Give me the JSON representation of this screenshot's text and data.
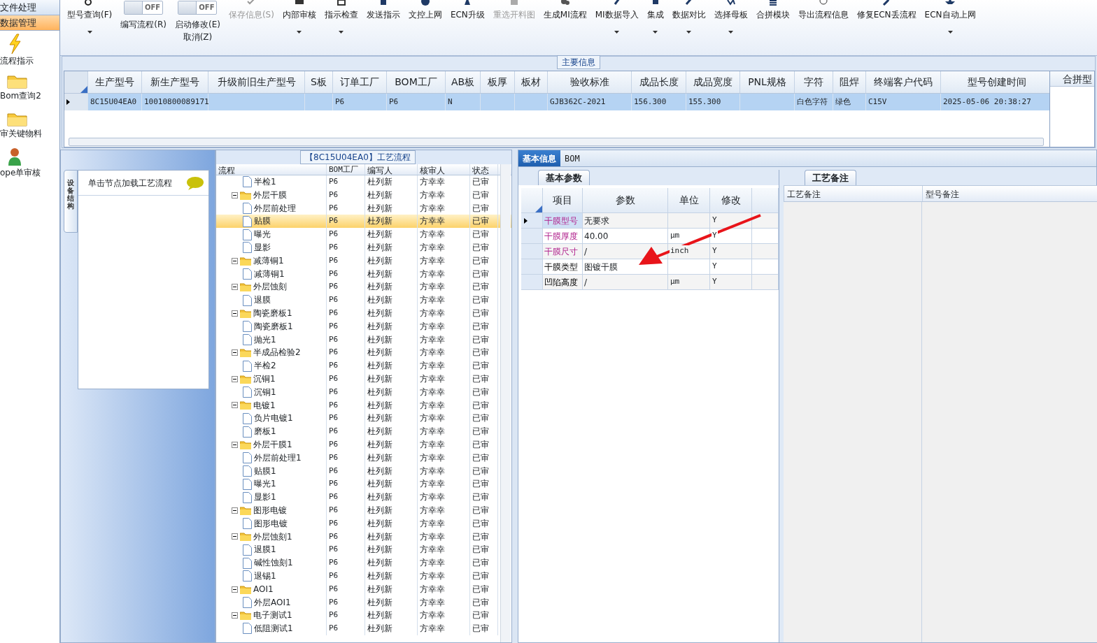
{
  "sidebar": {
    "sections": [
      {
        "label": "文件处理",
        "selected": false
      },
      {
        "label": "数据管理",
        "selected": true
      }
    ],
    "items": [
      {
        "label": "流程指示"
      },
      {
        "label": "Bom查询2"
      },
      {
        "label": "审关键物料"
      },
      {
        "label": "ope单审核"
      }
    ]
  },
  "toolbar": [
    {
      "kind": "button",
      "label": "型号查询(F)",
      "dropdown": true,
      "disabled": false
    },
    {
      "kind": "toggle",
      "label": "编写流程(R)",
      "switch_text": "OFF",
      "on": false
    },
    {
      "kind": "toggle",
      "label": "启动修改(E)",
      "sublabel": "取消(Z)",
      "switch_text": "OFF",
      "on": false
    },
    {
      "kind": "button",
      "label": "保存信息(S)",
      "dropdown": false,
      "disabled": true
    },
    {
      "kind": "button",
      "label": "内部审核",
      "dropdown": true,
      "disabled": false
    },
    {
      "kind": "button",
      "label": "指示检查",
      "dropdown": true,
      "disabled": false
    },
    {
      "kind": "button",
      "label": "发送指示",
      "dropdown": false,
      "disabled": false
    },
    {
      "kind": "button",
      "label": "文控上网",
      "dropdown": false,
      "disabled": false
    },
    {
      "kind": "button",
      "label": "ECN升级",
      "dropdown": false,
      "disabled": false
    },
    {
      "kind": "button",
      "label": "重选开料图",
      "dropdown": false,
      "disabled": true
    },
    {
      "kind": "button",
      "label": "生成MI流程",
      "dropdown": false,
      "disabled": false
    },
    {
      "kind": "button",
      "label": "MI数据导入",
      "dropdown": true,
      "disabled": false
    },
    {
      "kind": "button",
      "label": "集成",
      "dropdown": true,
      "disabled": false
    },
    {
      "kind": "button",
      "label": "数据对比",
      "dropdown": true,
      "disabled": false
    },
    {
      "kind": "button",
      "label": "选择母板",
      "dropdown": true,
      "disabled": false
    },
    {
      "kind": "button",
      "label": "合拼模块",
      "dropdown": false,
      "disabled": false
    },
    {
      "kind": "button",
      "label": "导出流程信息",
      "dropdown": false,
      "disabled": false
    },
    {
      "kind": "button",
      "label": "修复ECN丢流程",
      "dropdown": false,
      "disabled": false
    },
    {
      "kind": "button",
      "label": "ECN自动上网",
      "dropdown": true,
      "disabled": false
    }
  ],
  "main_info": {
    "title": "主要信息",
    "side_header": "合拼型",
    "columns": [
      "生产型号",
      "新生产型号",
      "升级前旧生产型号",
      "S板",
      "订单工厂",
      "BOM工厂",
      "AB板",
      "板厚",
      "板材",
      "验收标准",
      "成品长度",
      "成品宽度",
      "PNL规格",
      "字符",
      "阻焊",
      "终端客户代码",
      "型号创建时间"
    ],
    "rows": [
      {
        "selected": true,
        "cells": [
          "8C15U04EA0",
          "10010800089171",
          "",
          "",
          "P6",
          "P6",
          "N",
          "",
          "",
          "GJB362C-2021",
          "156.300",
          "155.300",
          "",
          "白色字符",
          "绿色",
          "C15V",
          "2025-05-06 20:38:27"
        ]
      }
    ]
  },
  "side_tab": {
    "label": "设备结构"
  },
  "node_panel": {
    "hint": "单击节点加载工艺流程"
  },
  "flow": {
    "title": "【8C15U04EA0】工艺流程",
    "columns": [
      "流程",
      "BOM工厂",
      "编写人",
      "核审人",
      "状态"
    ],
    "items": [
      {
        "kind": "leaf",
        "label": "半检1",
        "bom": "P6",
        "writer": "杜列新",
        "reviewer": "方幸幸",
        "status": "已审",
        "selected": false
      },
      {
        "kind": "folder",
        "label": "外层干膜",
        "bom": "P6",
        "writer": "杜列新",
        "reviewer": "方幸幸",
        "status": "已审",
        "selected": false,
        "expanded": true,
        "children": [
          {
            "kind": "leaf",
            "label": "外层前处理",
            "bom": "P6",
            "writer": "杜列新",
            "reviewer": "方幸幸",
            "status": "已审",
            "selected": false
          },
          {
            "kind": "leaf",
            "label": "贴膜",
            "bom": "P6",
            "writer": "杜列新",
            "reviewer": "方幸幸",
            "status": "已审",
            "selected": true
          },
          {
            "kind": "leaf",
            "label": "曝光",
            "bom": "P6",
            "writer": "杜列新",
            "reviewer": "方幸幸",
            "status": "已审",
            "selected": false
          },
          {
            "kind": "leaf",
            "label": "显影",
            "bom": "P6",
            "writer": "杜列新",
            "reviewer": "方幸幸",
            "status": "已审",
            "selected": false
          }
        ]
      },
      {
        "kind": "folder",
        "label": "减薄铜1",
        "bom": "P6",
        "writer": "杜列新",
        "reviewer": "方幸幸",
        "status": "已审",
        "selected": false,
        "expanded": true,
        "children": [
          {
            "kind": "leaf",
            "label": "减薄铜1",
            "bom": "P6",
            "writer": "杜列新",
            "reviewer": "方幸幸",
            "status": "已审",
            "selected": false
          }
        ]
      },
      {
        "kind": "folder",
        "label": "外层蚀刻",
        "bom": "P6",
        "writer": "杜列新",
        "reviewer": "方幸幸",
        "status": "已审",
        "selected": false,
        "expanded": true,
        "children": [
          {
            "kind": "leaf",
            "label": "退膜",
            "bom": "P6",
            "writer": "杜列新",
            "reviewer": "方幸幸",
            "status": "已审",
            "selected": false
          }
        ]
      },
      {
        "kind": "folder",
        "label": "陶瓷磨板1",
        "bom": "P6",
        "writer": "杜列新",
        "reviewer": "方幸幸",
        "status": "已审",
        "selected": false,
        "expanded": true,
        "children": [
          {
            "kind": "leaf",
            "label": "陶瓷磨板1",
            "bom": "P6",
            "writer": "杜列新",
            "reviewer": "方幸幸",
            "status": "已审",
            "selected": false
          },
          {
            "kind": "leaf",
            "label": "抛光1",
            "bom": "P6",
            "writer": "杜列新",
            "reviewer": "方幸幸",
            "status": "已审",
            "selected": false
          }
        ]
      },
      {
        "kind": "folder",
        "label": "半成品检验2",
        "bom": "P6",
        "writer": "杜列新",
        "reviewer": "方幸幸",
        "status": "已审",
        "selected": false,
        "expanded": true,
        "children": [
          {
            "kind": "leaf",
            "label": "半检2",
            "bom": "P6",
            "writer": "杜列新",
            "reviewer": "方幸幸",
            "status": "已审",
            "selected": false
          }
        ]
      },
      {
        "kind": "folder",
        "label": "沉铜1",
        "bom": "P6",
        "writer": "杜列新",
        "reviewer": "方幸幸",
        "status": "已审",
        "selected": false,
        "expanded": true,
        "children": [
          {
            "kind": "leaf",
            "label": "沉铜1",
            "bom": "P6",
            "writer": "杜列新",
            "reviewer": "方幸幸",
            "status": "已审",
            "selected": false
          }
        ]
      },
      {
        "kind": "folder",
        "label": "电镀1",
        "bom": "P6",
        "writer": "杜列新",
        "reviewer": "方幸幸",
        "status": "已审",
        "selected": false,
        "expanded": true,
        "children": [
          {
            "kind": "leaf",
            "label": "负片电镀1",
            "bom": "P6",
            "writer": "杜列新",
            "reviewer": "方幸幸",
            "status": "已审",
            "selected": false
          },
          {
            "kind": "leaf",
            "label": "磨板1",
            "bom": "P6",
            "writer": "杜列新",
            "reviewer": "方幸幸",
            "status": "已审",
            "selected": false
          }
        ]
      },
      {
        "kind": "folder",
        "label": "外层干膜1",
        "bom": "P6",
        "writer": "杜列新",
        "reviewer": "方幸幸",
        "status": "已审",
        "selected": false,
        "expanded": true,
        "children": [
          {
            "kind": "leaf",
            "label": "外层前处理1",
            "bom": "P6",
            "writer": "杜列新",
            "reviewer": "方幸幸",
            "status": "已审",
            "selected": false
          },
          {
            "kind": "leaf",
            "label": "贴膜1",
            "bom": "P6",
            "writer": "杜列新",
            "reviewer": "方幸幸",
            "status": "已审",
            "selected": false
          },
          {
            "kind": "leaf",
            "label": "曝光1",
            "bom": "P6",
            "writer": "杜列新",
            "reviewer": "方幸幸",
            "status": "已审",
            "selected": false
          },
          {
            "kind": "leaf",
            "label": "显影1",
            "bom": "P6",
            "writer": "杜列新",
            "reviewer": "方幸幸",
            "status": "已审",
            "selected": false
          }
        ]
      },
      {
        "kind": "folder",
        "label": "图形电镀",
        "bom": "P6",
        "writer": "杜列新",
        "reviewer": "方幸幸",
        "status": "已审",
        "selected": false,
        "expanded": true,
        "children": [
          {
            "kind": "leaf",
            "label": "图形电镀",
            "bom": "P6",
            "writer": "杜列新",
            "reviewer": "方幸幸",
            "status": "已审",
            "selected": false
          }
        ]
      },
      {
        "kind": "folder",
        "label": "外层蚀刻1",
        "bom": "P6",
        "writer": "杜列新",
        "reviewer": "方幸幸",
        "status": "已审",
        "selected": false,
        "expanded": true,
        "children": [
          {
            "kind": "leaf",
            "label": "退膜1",
            "bom": "P6",
            "writer": "杜列新",
            "reviewer": "方幸幸",
            "status": "已审",
            "selected": false
          },
          {
            "kind": "leaf",
            "label": "碱性蚀刻1",
            "bom": "P6",
            "writer": "杜列新",
            "reviewer": "方幸幸",
            "status": "已审",
            "selected": false
          },
          {
            "kind": "leaf",
            "label": "退锡1",
            "bom": "P6",
            "writer": "杜列新",
            "reviewer": "方幸幸",
            "status": "已审",
            "selected": false
          }
        ]
      },
      {
        "kind": "folder",
        "label": "AOI1",
        "bom": "P6",
        "writer": "杜列新",
        "reviewer": "方幸幸",
        "status": "已审",
        "selected": false,
        "expanded": true,
        "children": [
          {
            "kind": "leaf",
            "label": "外层AOI1",
            "bom": "P6",
            "writer": "杜列新",
            "reviewer": "方幸幸",
            "status": "已审",
            "selected": false
          }
        ]
      },
      {
        "kind": "folder",
        "label": "电子测试1",
        "bom": "P6",
        "writer": "杜列新",
        "reviewer": "方幸幸",
        "status": "已审",
        "selected": false,
        "expanded": true,
        "children": [
          {
            "kind": "leaf",
            "label": "低阻测试1",
            "bom": "P6",
            "writer": "杜列新",
            "reviewer": "方幸幸",
            "status": "已审",
            "selected": false
          }
        ]
      }
    ]
  },
  "detail": {
    "tabs": [
      {
        "label": "基本信息",
        "selected": true
      },
      {
        "label": "BOM",
        "selected": false
      }
    ],
    "subtab": "基本参数",
    "columns": [
      "项目",
      "参数",
      "单位",
      "修改"
    ],
    "rows": [
      {
        "item": "干膜型号",
        "highlighted": true,
        "value": "无要求",
        "unit": "",
        "modify": "Y",
        "selected": true
      },
      {
        "item": "干膜厚度",
        "highlighted": true,
        "value": "40.00",
        "unit": "μm",
        "modify": "Y",
        "selected": false
      },
      {
        "item": "干膜尺寸",
        "highlighted": true,
        "value": "/",
        "unit": "inch",
        "modify": "Y",
        "selected": false
      },
      {
        "item": "干膜类型",
        "highlighted": false,
        "value": "图镀干膜",
        "unit": "",
        "modify": "Y",
        "selected": false
      },
      {
        "item": "凹陷高度",
        "highlighted": false,
        "value": "/",
        "unit": "μm",
        "modify": "Y",
        "selected": false
      }
    ]
  },
  "notes": {
    "tab": "工艺备注",
    "columns": [
      "工艺备注",
      "型号备注"
    ]
  }
}
